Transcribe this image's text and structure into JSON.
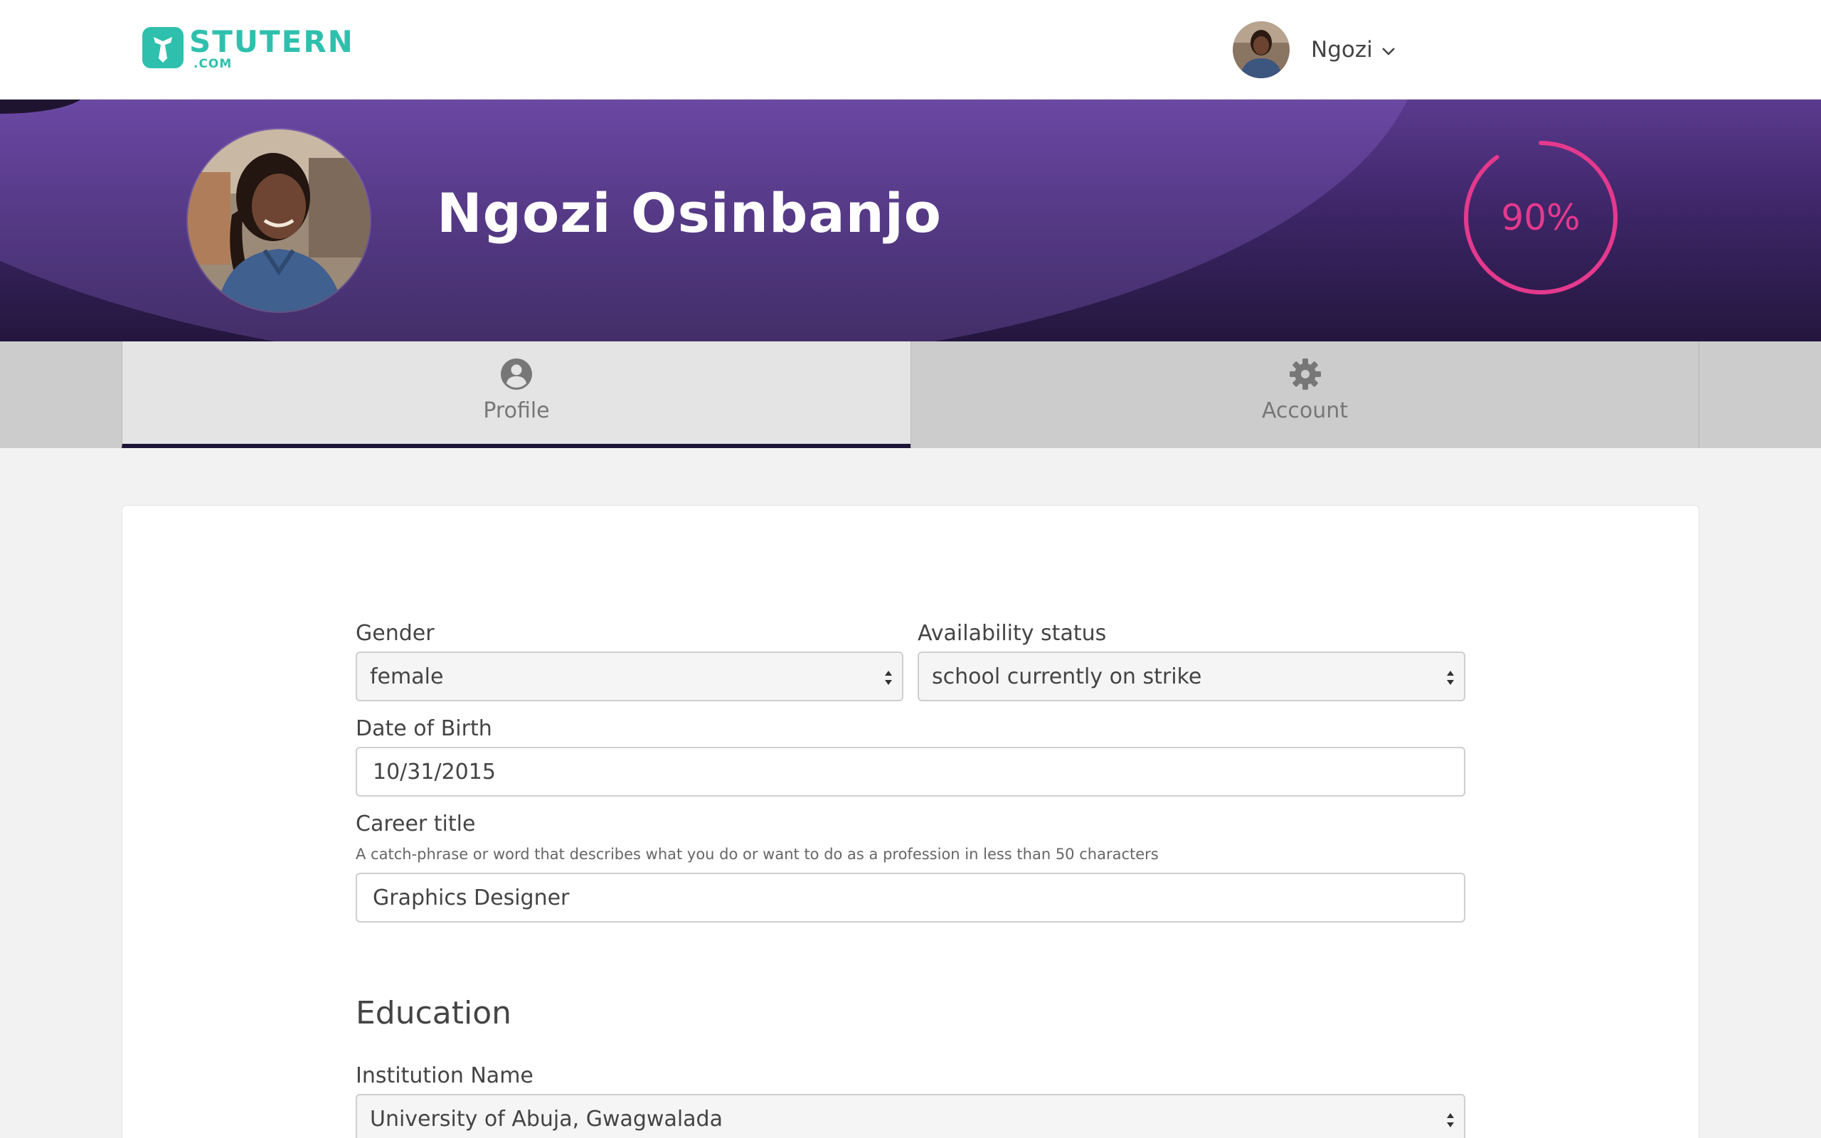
{
  "brand": {
    "name": "STUTERN",
    "suffix": ".COM",
    "color": "#2fc0ad"
  },
  "user_menu": {
    "name": "Ngozi",
    "avatar_icon": "user-photo",
    "caret_icon": "chevron-down-icon"
  },
  "profile": {
    "full_name": "Ngozi Osinbanjo",
    "photo_icon": "user-photo"
  },
  "completion": {
    "value": 0.9,
    "label": "90%",
    "color": "#e5398e"
  },
  "tabs": [
    {
      "label": "Profile",
      "icon": "user-circle-icon",
      "active": true
    },
    {
      "label": "Account",
      "icon": "gear-icon",
      "active": false
    }
  ],
  "form": {
    "gender": {
      "label": "Gender",
      "value": "female"
    },
    "availability": {
      "label": "Availability status",
      "value": "school currently on strike"
    },
    "dob": {
      "label": "Date of Birth",
      "value": "10/31/2015"
    },
    "career": {
      "label": "Career title",
      "hint": "A catch-phrase or word that describes what you do or want to do as a profession in less than 50 characters",
      "value": "Graphics Designer"
    }
  },
  "education": {
    "title": "Education",
    "institution": {
      "label": "Institution Name",
      "value": "University of Abuja, Gwagwalada"
    }
  },
  "colors": {
    "banner_top": "#5a3a8e",
    "banner_bottom": "#23163d",
    "active_tab_underline": "#1e1438"
  }
}
